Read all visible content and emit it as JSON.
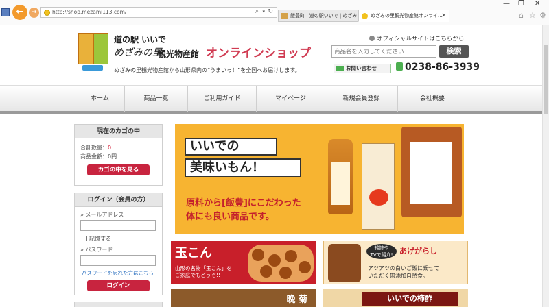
{
  "browser": {
    "url": "http://shop.mezami113.com/",
    "tabs": [
      {
        "label": "飯豊町 | 道の駅いいで | めざみの..."
      },
      {
        "label": "めざみの里観光物産館オンライ..."
      }
    ],
    "win_min": "—",
    "win_max": "❐",
    "win_close": "✕"
  },
  "header": {
    "site_name": "道の駅 いいで",
    "brand": "めざみの里",
    "site_sub": "観光物産館",
    "shop_title": "オンラインショップ",
    "tagline": "めざみの里観光物産館から山形県内の“うまいっ！”を全国へお届けします。",
    "official_link": "オフィシャルサイトはこちらから",
    "search_placeholder": "商品名を入力してください",
    "search_button": "検索",
    "contact_label": "お問い合わせ",
    "phone": "0238-86-3939"
  },
  "nav": {
    "items": [
      "ホーム",
      "商品一覧",
      "ご利用ガイド",
      "マイページ",
      "新規会員登録",
      "会社概要"
    ]
  },
  "cart": {
    "title": "現在のカゴの中",
    "count_label": "合計数量：",
    "count_value": "0",
    "amount_label": "商品金額：0円",
    "button": "カゴの中を見る"
  },
  "login": {
    "title": "ログイン（会員の方）",
    "email_label": "» メールアドレス",
    "remember_label": "記憶する",
    "password_label": "» パスワード",
    "forgot_link": "パスワードを忘れた方はこちら",
    "button": "ログイン"
  },
  "banner": {
    "catch1": "いいでの",
    "catch2": "美味いもん！",
    "desc1": "原料から[飯豊]にこだわった",
    "desc2": "体にも良い商品です。"
  },
  "promos": {
    "tama_title": "玉こん",
    "tama_desc1": "山形の名物「玉こん」を",
    "tama_desc2": "ご家庭でもどうぞ!!",
    "age_badge1": "雑誌や",
    "age_badge2": "TVで紹介!",
    "age_name": "あげがらし",
    "age_desc1": "アツアツの白いご飯に乗せて",
    "age_desc2": "いただく無添加自然食。",
    "bangiku": "晩 菊",
    "kaki": "いいでの柿酢"
  }
}
